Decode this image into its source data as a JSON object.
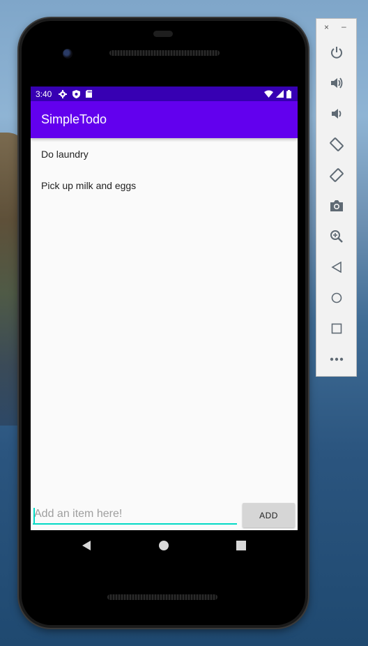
{
  "status_bar": {
    "time": "3:40"
  },
  "app": {
    "title": "SimpleTodo",
    "items": [
      {
        "label": "Do laundry"
      },
      {
        "label": "Pick up milk and eggs"
      }
    ],
    "input": {
      "value": "",
      "placeholder": "Add an item here!"
    },
    "add_button_label": "ADD"
  },
  "emulator_panel": {
    "close_label": "×",
    "minimize_label": "–",
    "buttons": [
      "power-icon",
      "volume-up-icon",
      "volume-down-icon",
      "rotate-left-icon",
      "rotate-right-icon",
      "camera-icon",
      "zoom-icon",
      "back-icon",
      "home-icon",
      "overview-icon",
      "more-icon"
    ]
  },
  "colors": {
    "status_bar": "#3700b3",
    "app_bar": "#6200ee",
    "input_accent": "#03dac5",
    "button_bg": "#d6d6d6",
    "panel_icon": "#5f6a74"
  }
}
